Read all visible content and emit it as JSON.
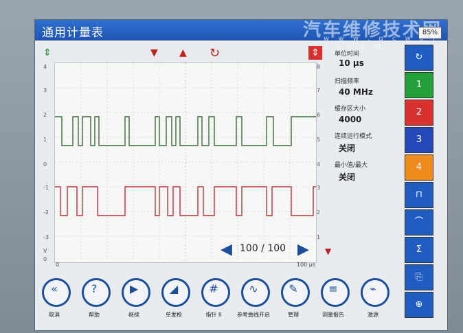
{
  "title": "通用计量表",
  "watermark": {
    "text": "汽车维修技术网",
    "url": "w w w . q c w x j s . c o m"
  },
  "battery": "85%",
  "toolbar": {
    "down": "▼",
    "up": "▲",
    "reset": "↻",
    "updown": "⇕"
  },
  "left_axis": {
    "ticks": [
      "4",
      "3",
      "2",
      "1",
      "0",
      "-1",
      "-2",
      "-3",
      "V",
      "0"
    ]
  },
  "right_axis": {
    "ticks": [
      "8",
      "7",
      "6",
      "5",
      "4",
      "3",
      "2",
      "1"
    ]
  },
  "bottom_axis": {
    "left": "0",
    "right": "100 μs"
  },
  "nav": {
    "prev": "◀",
    "count": "100 / 100",
    "next": "▶"
  },
  "settings": {
    "unit_time_label": "单位时间",
    "unit_time_value": "10 μs",
    "scan_rate_label": "扫描频率",
    "scan_rate_value": "40 MHz",
    "buffer_label": "缓存区大小",
    "buffer_value": "4000",
    "continuous_label": "连续运行模式",
    "continuous_value": "关闭",
    "minmax_label": "最小值/最大",
    "minmax_value": "关闭"
  },
  "sidebar": {
    "top": "↻",
    "ch1": "1",
    "ch2": "2",
    "ch3": "3",
    "ch4": "4",
    "colors": {
      "ch1": "#22a13a",
      "ch2": "#d8322f",
      "ch3": "#2448b8",
      "ch4": "#ef8a1c",
      "blue": "#1f5cc2"
    },
    "b6": "⊓",
    "b7": "⌒",
    "b8": "Σ",
    "b9": "⎘",
    "b10": "⊕"
  },
  "bottom_buttons": [
    {
      "label": "取消",
      "icon": "«"
    },
    {
      "label": "帮助",
      "icon": "?"
    },
    {
      "label": "继续",
      "icon": "▶"
    },
    {
      "label": "单发枪",
      "icon": "◢"
    },
    {
      "label": "指针 II",
      "icon": "#"
    },
    {
      "label": "参考曲线开启",
      "icon": "∿"
    },
    {
      "label": "管理",
      "icon": "✎"
    },
    {
      "label": "测量报告",
      "icon": "≡"
    },
    {
      "label": "激源",
      "icon": "⌁"
    }
  ]
}
